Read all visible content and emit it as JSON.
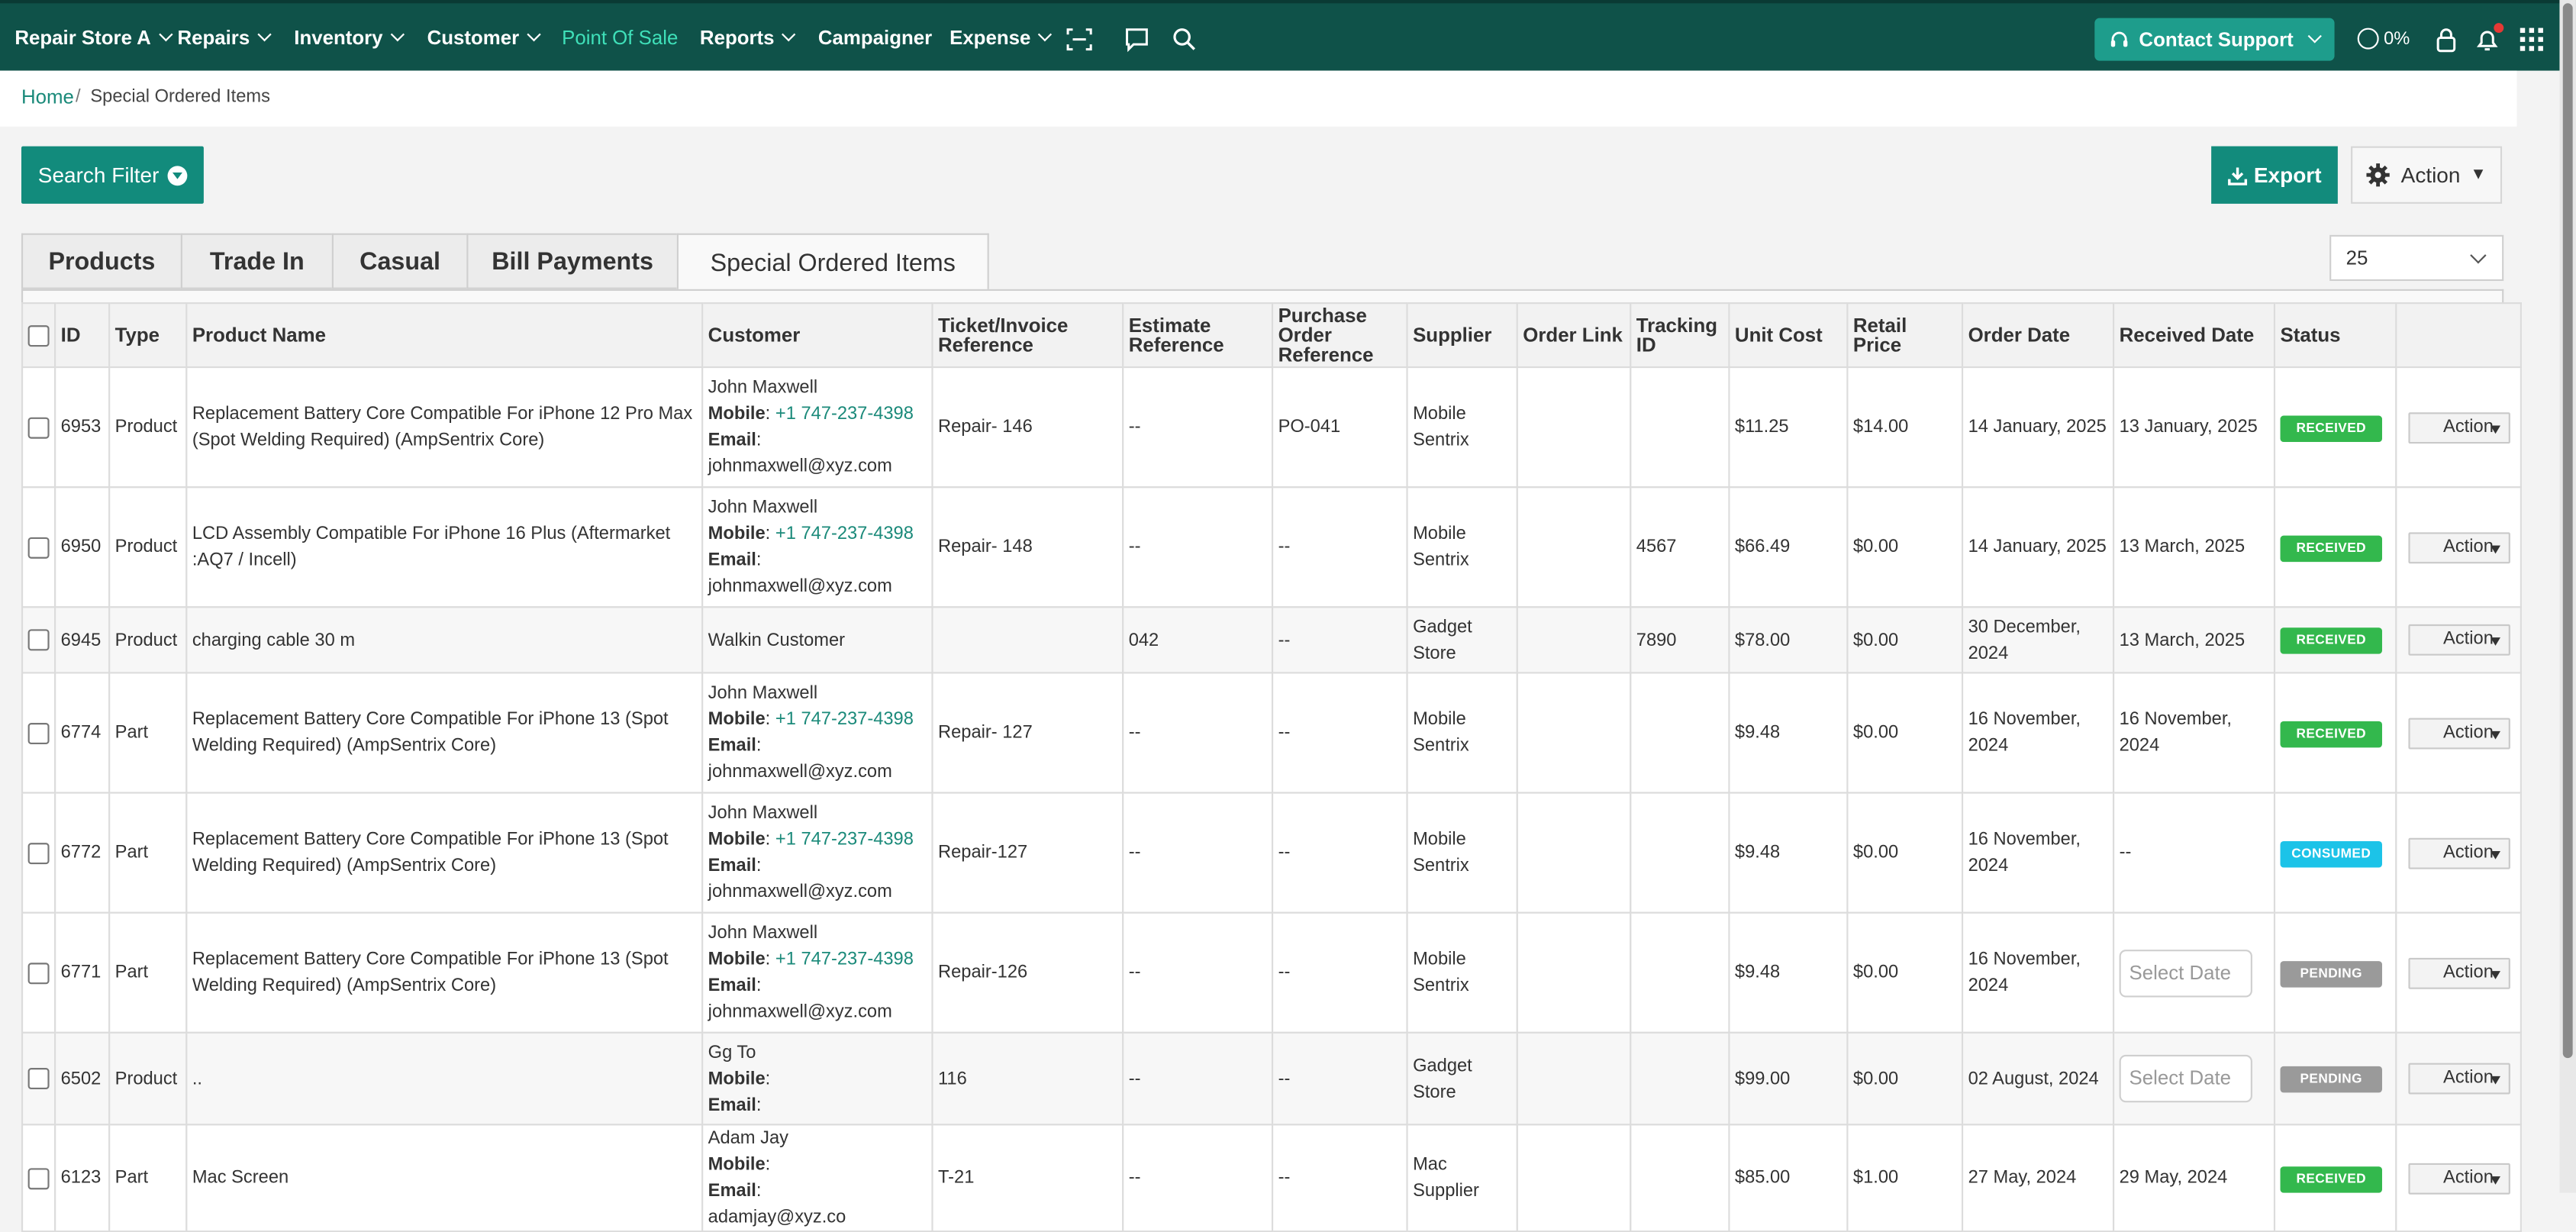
{
  "colors": {
    "nav_bg": "#0f5249",
    "accent": "#128b7c",
    "active_nav": "#3fe0b9",
    "received": "#33b84d",
    "consumed": "#1cc3e8",
    "pending": "#9a9a9a"
  },
  "nav": {
    "store": "Repair Store A",
    "repairs": "Repairs",
    "inventory": "Inventory",
    "customer": "Customer",
    "pos": "Point Of Sale",
    "reports": "Reports",
    "campaigner": "Campaigner",
    "expense": "Expense",
    "icons": [
      "scan-icon",
      "chat-icon",
      "search-icon"
    ],
    "support": "Contact Support",
    "progress": "0%",
    "right_icons": [
      "lock-icon",
      "bell-icon",
      "apps-grid-icon"
    ]
  },
  "breadcrumb": {
    "home": "Home",
    "separator": "/",
    "current": "Special Ordered Items"
  },
  "toolbar": {
    "search_filter": "Search Filter",
    "export": "Export",
    "action": "Action"
  },
  "tabs": [
    "Products",
    "Trade In",
    "Casual",
    "Bill Payments",
    "Special Ordered Items"
  ],
  "page_size": "25",
  "columns": [
    "ID",
    "Type",
    "Product Name",
    "Customer",
    "Ticket/Invoice Reference",
    "Estimate Reference",
    "Purchase Order Reference",
    "Supplier",
    "Order Link",
    "Tracking ID",
    "Unit Cost",
    "Retail Price",
    "Order Date",
    "Received Date",
    "Status",
    ""
  ],
  "labels": {
    "mobile": "Mobile",
    "email": "Email",
    "row_action": "Action",
    "date_placeholder": "Select Date"
  },
  "rows": [
    {
      "id": "6953",
      "type": "Product",
      "product": "Replacement Battery Core Compatible For iPhone 12 Pro Max (Spot Welding Required) (AmpSentrix Core)",
      "cust_name": "John Maxwell",
      "cust_mobile": "+1 747-237-4398",
      "cust_email": "johnmaxwell@xyz.com",
      "ticket": "Repair- 146",
      "estimate": "--",
      "po": "PO-041",
      "supplier": "Mobile Sentrix",
      "order_link": "",
      "tracking": "",
      "unit_cost": "$11.25",
      "retail": "$14.00",
      "order_date": "14 January, 2025",
      "received": "13 January, 2025",
      "status": "RECEIVED"
    },
    {
      "id": "6950",
      "type": "Product",
      "product": "LCD Assembly Compatible For iPhone 16 Plus (Aftermarket :AQ7 / Incell)",
      "cust_name": "John Maxwell",
      "cust_mobile": "+1 747-237-4398",
      "cust_email": "johnmaxwell@xyz.com",
      "ticket": "Repair- 148",
      "estimate": "--",
      "po": "--",
      "supplier": "Mobile Sentrix",
      "order_link": "",
      "tracking": "4567",
      "unit_cost": "$66.49",
      "retail": "$0.00",
      "order_date": "14 January, 2025",
      "received": "13 March, 2025",
      "status": "RECEIVED"
    },
    {
      "id": "6945",
      "type": "Product",
      "product": "charging cable 30 m",
      "cust_name": "Walkin Customer",
      "ticket": "",
      "estimate": "042",
      "po": "--",
      "supplier": "Gadget Store",
      "order_link": "",
      "tracking": "7890",
      "unit_cost": "$78.00",
      "retail": "$0.00",
      "order_date": "30 December, 2024",
      "received": "13 March, 2025",
      "status": "RECEIVED"
    },
    {
      "id": "6774",
      "type": "Part",
      "product": "Replacement Battery Core Compatible For iPhone 13 (Spot Welding Required) (AmpSentrix Core)",
      "cust_name": "John Maxwell",
      "cust_mobile": "+1 747-237-4398",
      "cust_email": "johnmaxwell@xyz.com",
      "ticket": "Repair- 127",
      "estimate": "--",
      "po": "--",
      "supplier": "Mobile Sentrix",
      "order_link": "",
      "tracking": "",
      "unit_cost": "$9.48",
      "retail": "$0.00",
      "order_date": "16 November, 2024",
      "received": "16 November, 2024",
      "status": "RECEIVED"
    },
    {
      "id": "6772",
      "type": "Part",
      "product": "Replacement Battery Core Compatible For iPhone 13 (Spot Welding Required) (AmpSentrix Core)",
      "cust_name": "John Maxwell",
      "cust_mobile": "+1 747-237-4398",
      "cust_email": "johnmaxwell@xyz.com",
      "ticket": "Repair-127",
      "estimate": "--",
      "po": "--",
      "supplier": "Mobile Sentrix",
      "order_link": "",
      "tracking": "",
      "unit_cost": "$9.48",
      "retail": "$0.00",
      "order_date": "16 November, 2024",
      "received": "--",
      "status": "CONSUMED"
    },
    {
      "id": "6771",
      "type": "Part",
      "product": "Replacement Battery Core Compatible For iPhone 13 (Spot Welding Required) (AmpSentrix Core)",
      "cust_name": "John Maxwell",
      "cust_mobile": "+1 747-237-4398",
      "cust_email": "johnmaxwell@xyz.com",
      "ticket": "Repair-126",
      "estimate": "--",
      "po": "--",
      "supplier": "Mobile Sentrix",
      "order_link": "",
      "tracking": "",
      "unit_cost": "$9.48",
      "retail": "$0.00",
      "order_date": "16 November, 2024",
      "received": "",
      "status": "PENDING"
    },
    {
      "id": "6502",
      "type": "Product",
      "product": "..",
      "cust_name": "Gg To",
      "cust_mobile": "",
      "cust_email": "",
      "ticket": "116",
      "estimate": "--",
      "po": "--",
      "supplier": "Gadget Store",
      "order_link": "",
      "tracking": "",
      "unit_cost": "$99.00",
      "retail": "$0.00",
      "order_date": "02 August, 2024",
      "received": "",
      "status": "PENDING"
    },
    {
      "id": "6123",
      "type": "Part",
      "product": "Mac Screen",
      "cust_name": "Adam Jay",
      "cust_mobile": "",
      "cust_email": "adamjay@xyz.co",
      "ticket": "T-21",
      "estimate": "--",
      "po": "--",
      "supplier": "Mac Supplier",
      "order_link": "",
      "tracking": "",
      "unit_cost": "$85.00",
      "retail": "$1.00",
      "order_date": "27 May, 2024",
      "received": "29 May, 2024",
      "status": "RECEIVED"
    }
  ]
}
